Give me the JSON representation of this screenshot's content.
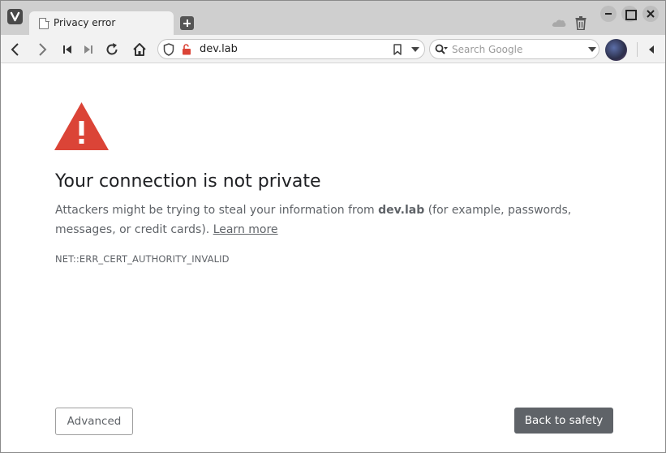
{
  "tab": {
    "title": "Privacy error"
  },
  "address_bar": {
    "url": "dev.lab"
  },
  "search": {
    "placeholder": "Search Google"
  },
  "icons": {
    "browser_menu": "vivaldi-logo-icon",
    "new_tab": "plus-icon",
    "cloud": "cloud-icon",
    "trash": "trash-icon",
    "back": "arrow-left-icon",
    "forward": "arrow-right-icon",
    "rewind": "skip-back-icon",
    "fast_forward": "skip-forward-icon",
    "reload": "reload-icon",
    "home": "home-icon",
    "shield": "shield-icon",
    "insecure_lock": "unlocked-red-icon",
    "bookmark": "bookmark-icon",
    "search_engine": "magnifier-icon",
    "warning": "warning-triangle-icon"
  },
  "colors": {
    "warning_red": "#db4437",
    "primary_button": "#5f6368",
    "text": "#202124",
    "secondary_text": "#5f6368"
  },
  "page": {
    "heading": "Your connection is not private",
    "message_before": "Attackers might be trying to steal your information from ",
    "message_host": "dev.lab",
    "message_after": " (for example, passwords, messages, or credit cards). ",
    "learn_more": "Learn more",
    "error_code": "NET::ERR_CERT_AUTHORITY_INVALID",
    "advanced_button": "Advanced",
    "back_button": "Back to safety"
  }
}
